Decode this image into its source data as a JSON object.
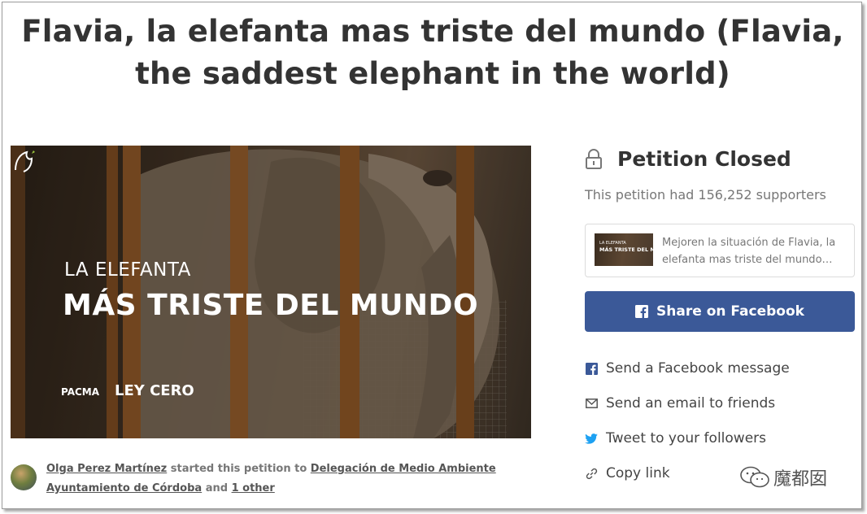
{
  "page": {
    "title": "Flavia, la elefanta mas triste del mundo (Flavia, the saddest elephant in the world)"
  },
  "hero": {
    "line1": "LA ELEFANTA",
    "line2": "MÁS TRISTE DEL MUNDO",
    "logo_left": "PACMA",
    "logo_right": "LEY CERO"
  },
  "starter": {
    "author": "Olga Perez Martínez",
    "middle": " started this petition to ",
    "target": "Delegación de Medio Ambiente Ayuntamiento de Córdoba",
    "and": " and ",
    "others": "1 other"
  },
  "status": {
    "icon": "lock-icon",
    "title": "Petition Closed",
    "supporters": "This petition had 156,252 supporters"
  },
  "preview": {
    "thumb_line1": "LA ELEFANTA",
    "thumb_line2": "MÁS TRISTE DEL MUNDO",
    "text": "Mejoren la situación de Flavia, la elefanta mas triste del mundo…"
  },
  "share": {
    "facebook_button": "Share on Facebook",
    "facebook_message": "Send a Facebook message",
    "email": "Send an email to friends",
    "tweet": "Tweet to your followers",
    "copy_link": "Copy link"
  },
  "watermark": {
    "text": "魔都囡"
  },
  "colors": {
    "facebook": "#3b5998",
    "twitter": "#1da1f2",
    "text_dark": "#333333",
    "text_muted": "#777777"
  }
}
